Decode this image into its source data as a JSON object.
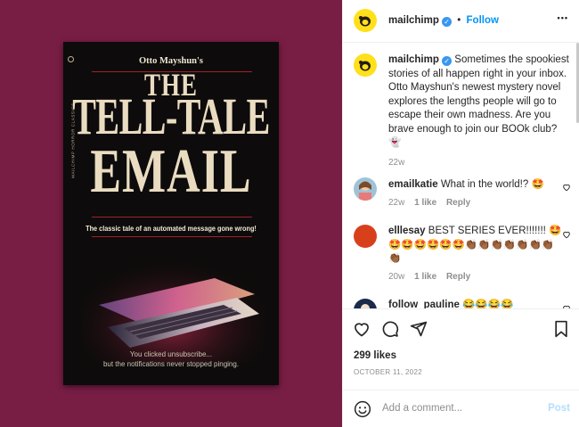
{
  "post": {
    "username": "mailchimp",
    "follow_sep": "•",
    "follow_label": "Follow",
    "more_label": "•••"
  },
  "book": {
    "author": "Otto Mayshun's",
    "title_line1": "THE",
    "title_line2": "TELL-TALE",
    "title_line3": "EMAIL",
    "tagline": "The classic tale of an automated message gone wrong!",
    "footer_line1": "You clicked unsubscribe...",
    "footer_line2": "but the notifications never stopped pinging.",
    "spine": "MAILCHIMP HORROR CLASSICS"
  },
  "caption": {
    "username": "mailchimp",
    "text": "Sometimes the spookiest stories of all happen right in your inbox. Otto Mayshun's newest mystery novel explores the lengths people will go to escape their own madness. Are you brave enough to join our BOOk club? 👻",
    "time": "22w"
  },
  "comments": [
    {
      "username": "emailkatie",
      "text": "What in the world!? 🤩",
      "time": "22w",
      "likes": "1 like",
      "reply": "Reply"
    },
    {
      "username": "elllesay",
      "text": "BEST SERIES EVER!!!!!!! 🤩🤩🤩🤩🤩🤩🤩👏🏾👏🏾👏🏾👏🏾👏🏾👏🏾👏🏾👏🏾",
      "time": "20w",
      "likes": "1 like",
      "reply": "Reply"
    },
    {
      "username": "follow_pauline",
      "text": "😂😂😂😂",
      "time": "",
      "likes": "",
      "reply": ""
    }
  ],
  "stats": {
    "likes": "299 likes",
    "date": "OCTOBER 11, 2022"
  },
  "add_comment": {
    "placeholder": "Add a comment...",
    "post_label": "Post"
  },
  "colors": {
    "media_bg": "#781d44",
    "brand_yellow": "#ffe01b",
    "link_blue": "#0095f6"
  }
}
